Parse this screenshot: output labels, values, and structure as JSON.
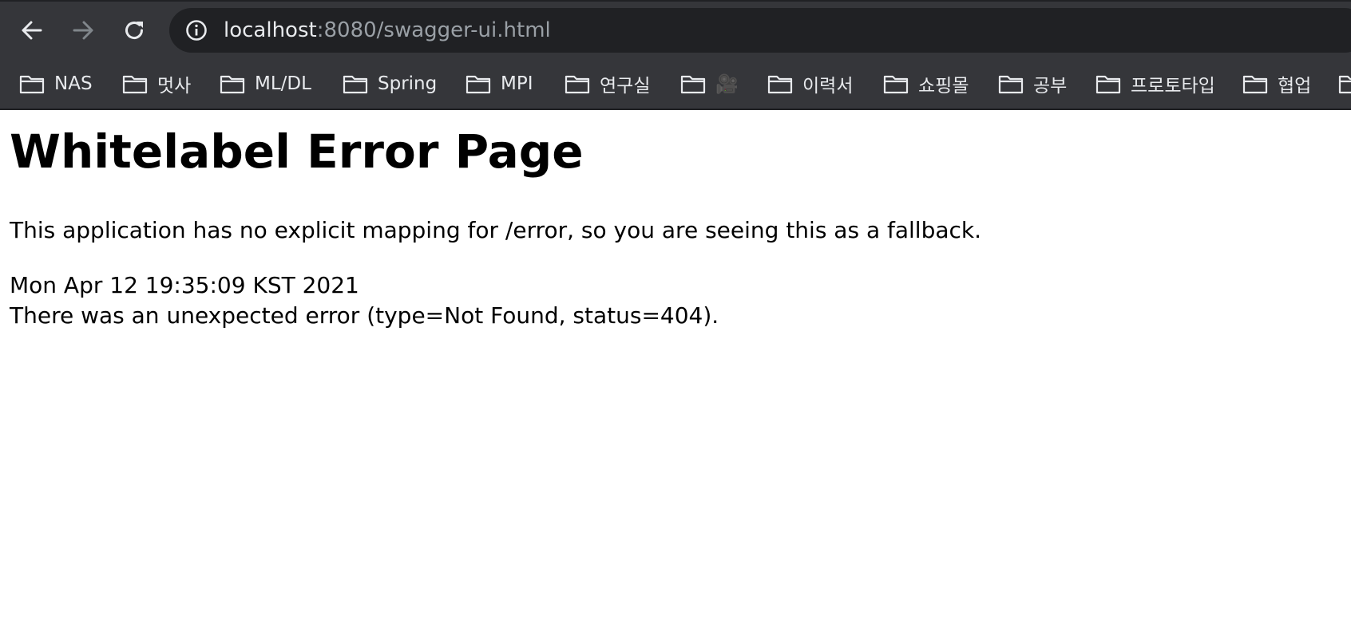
{
  "browser": {
    "url_host": "localhost",
    "url_rest": ":8080/swagger-ui.html",
    "icons": {
      "back": "arrow-left-icon",
      "forward": "arrow-right-icon",
      "reload": "reload-icon",
      "info": "info-icon",
      "folder": "folder-icon"
    }
  },
  "bookmarks": [
    {
      "label": "NAS"
    },
    {
      "label": "멋사"
    },
    {
      "label": "ML/DL"
    },
    {
      "label": "Spring"
    },
    {
      "label": "MPI"
    },
    {
      "label": "연구실"
    },
    {
      "label": "🎥"
    },
    {
      "label": "이력서"
    },
    {
      "label": "쇼핑몰"
    },
    {
      "label": "공부"
    },
    {
      "label": "프로토타입"
    },
    {
      "label": "협업"
    },
    {
      "label": ""
    }
  ],
  "page": {
    "title": "Whitelabel Error Page",
    "message": "This application has no explicit mapping for /error, so you are seeing this as a fallback.",
    "timestamp": "Mon Apr 12 19:35:09 KST 2021",
    "error": "There was an unexpected error (type=Not Found, status=404)."
  },
  "colors": {
    "toolbar_bg": "#35363a",
    "omnibox_bg": "#202124",
    "url_host": "#e8eaed",
    "url_rest": "#9aa0a6",
    "icon_active": "#e8eaed",
    "icon_disabled": "#80868b"
  }
}
